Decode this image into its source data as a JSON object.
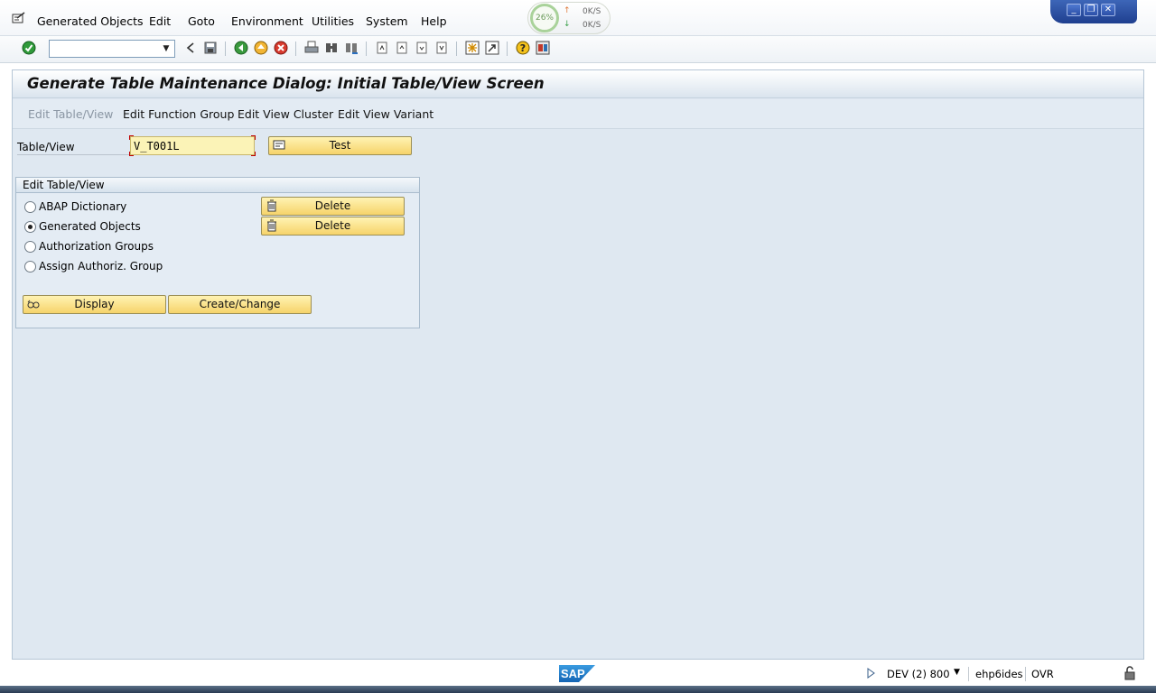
{
  "menubar": {
    "items": [
      {
        "label": "Generated Objects"
      },
      {
        "label": "Edit"
      },
      {
        "label": "Goto"
      },
      {
        "label": "Environment"
      },
      {
        "label": "Utilities"
      },
      {
        "label": "System"
      },
      {
        "label": "Help"
      }
    ],
    "net_widget": {
      "percent": "26%",
      "up_rate": "0K/S",
      "down_rate": "0K/S"
    }
  },
  "toolbar": {
    "command_field": {
      "value": "",
      "placeholder": ""
    }
  },
  "screen": {
    "title": "Generate Table Maintenance Dialog: Initial Table/View Screen",
    "app_toolbar": [
      {
        "label": "Edit Table/View",
        "enabled": false
      },
      {
        "label": "Edit Function Group",
        "enabled": true
      },
      {
        "label": "Edit View Cluster",
        "enabled": true
      },
      {
        "label": "Edit View Variant",
        "enabled": true
      }
    ],
    "table_view": {
      "label": "Table/View",
      "value": "V_T001L"
    },
    "test_button": "Test",
    "group": {
      "title": "Edit Table/View",
      "options": [
        {
          "label": "ABAP Dictionary",
          "checked": false
        },
        {
          "label": "Generated Objects",
          "checked": true
        },
        {
          "label": "Authorization Groups",
          "checked": false
        },
        {
          "label": "Assign Authoriz. Group",
          "checked": false
        }
      ],
      "delete_label": "Delete",
      "display_button": "Display",
      "create_change_button": "Create/Change"
    }
  },
  "statusbar": {
    "logo": "SAP",
    "system": "DEV (2) 800",
    "server": "ehp6ides",
    "mode": "OVR"
  },
  "colors": {
    "button_yellow": "#f6d36a",
    "screen_bg": "#dfe8f1",
    "field_yellow": "#fbf3b7"
  }
}
